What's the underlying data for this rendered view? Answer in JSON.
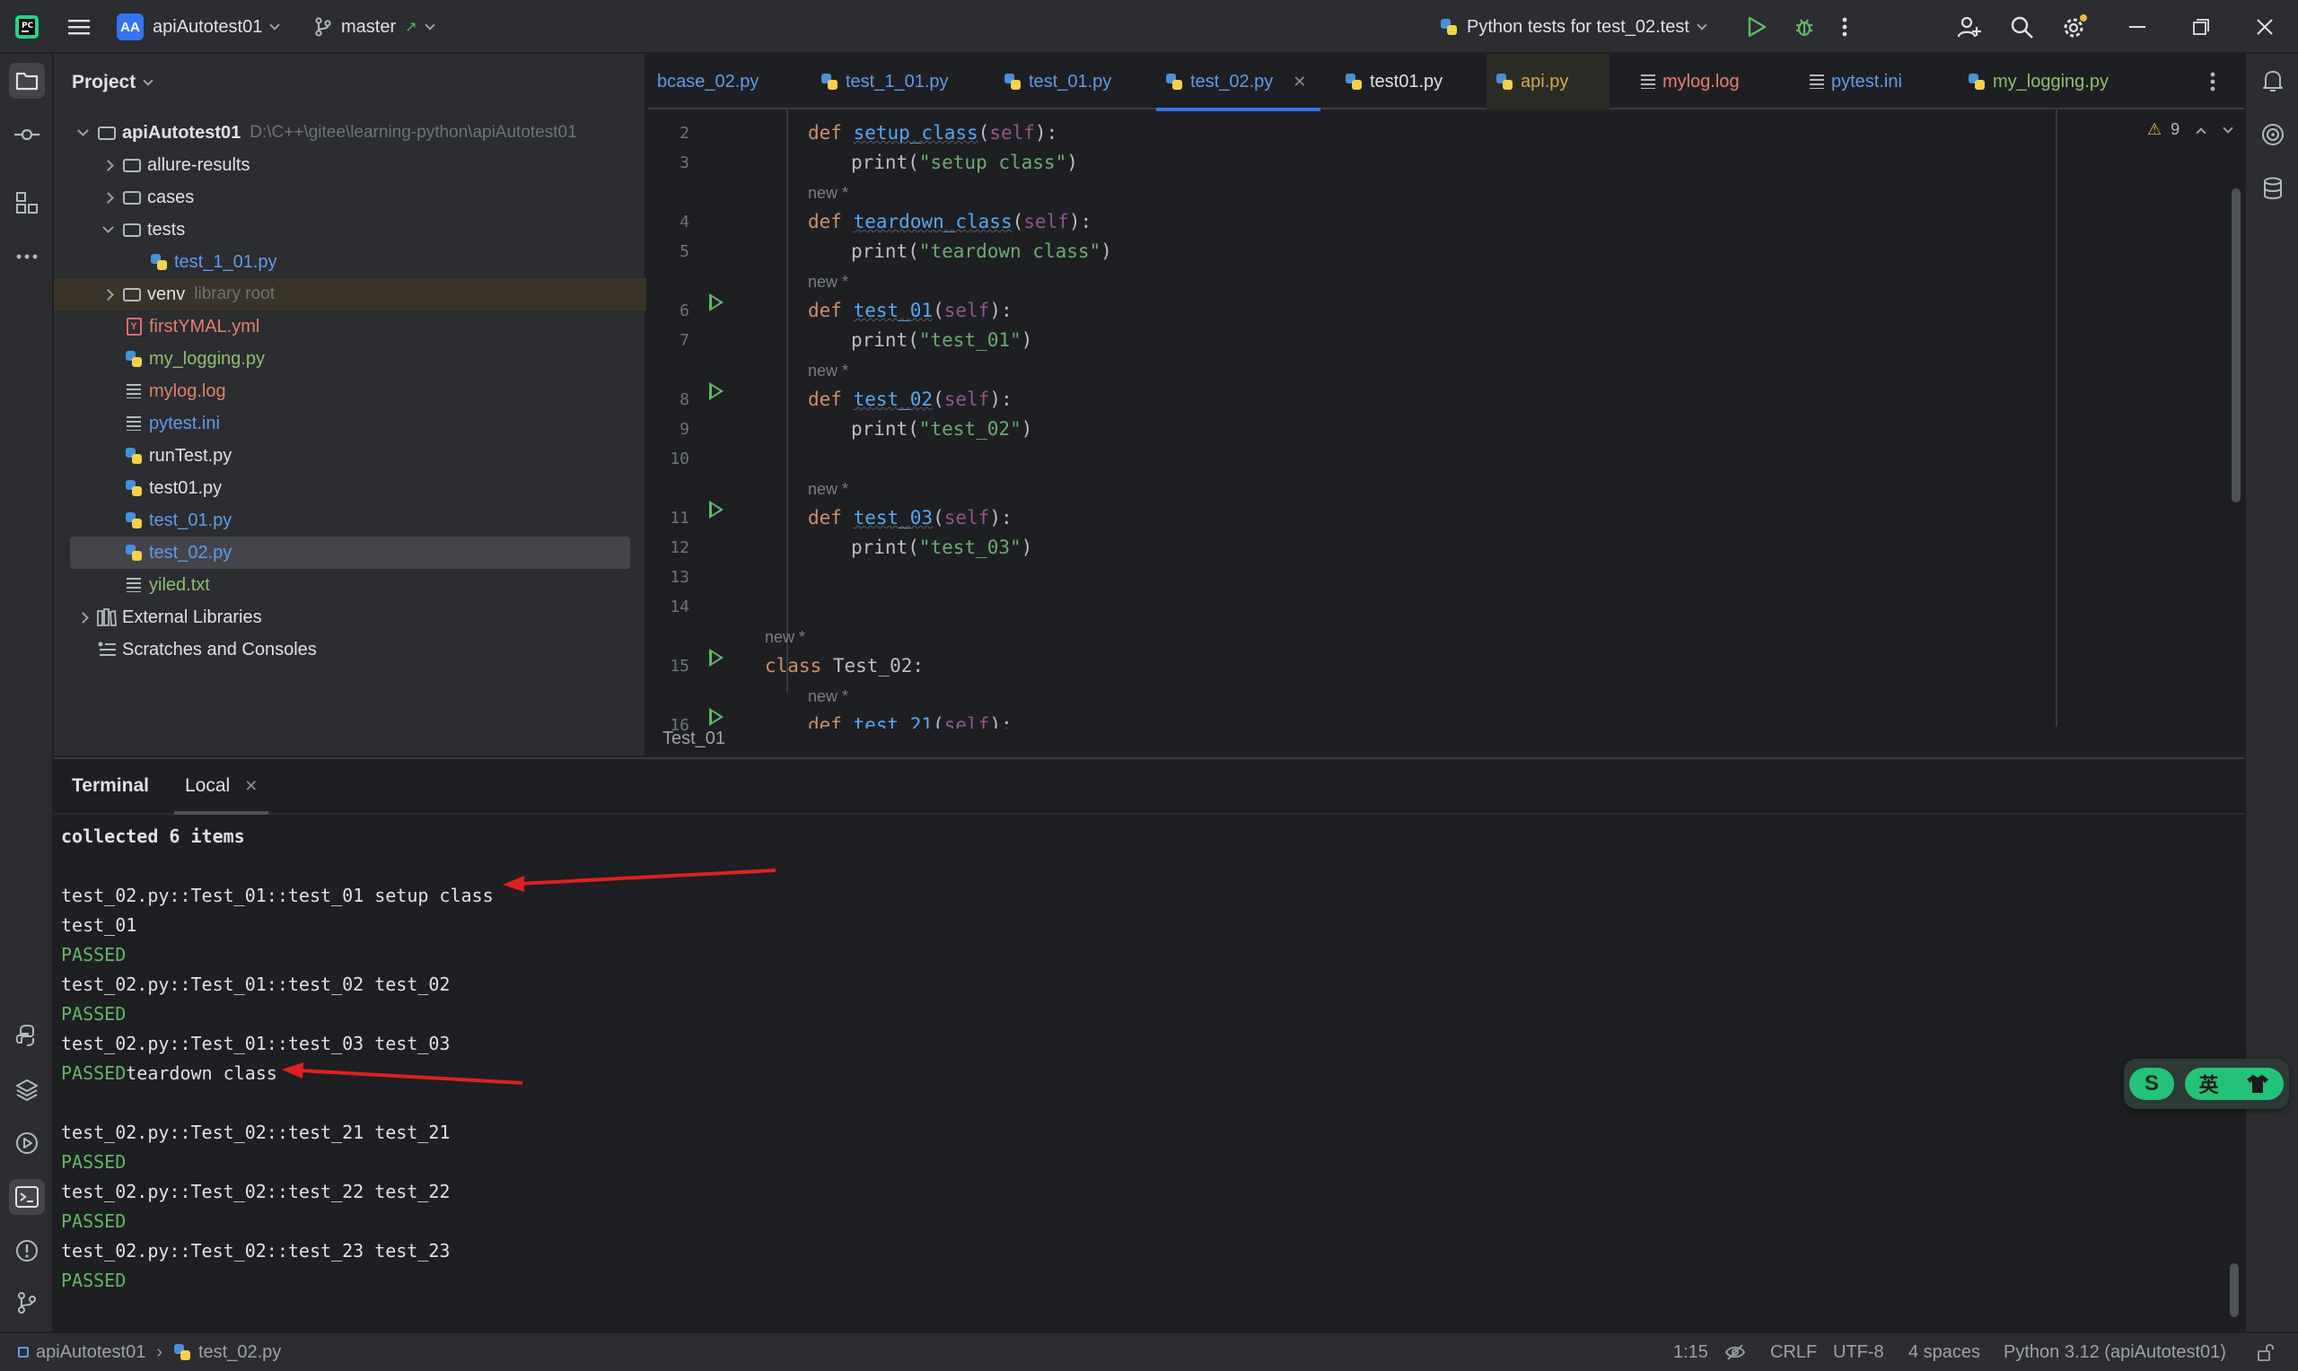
{
  "titlebar": {
    "project_badge": "AA",
    "project_name": "apiAutotest01",
    "branch": "master",
    "run_config": "Python tests for test_02.test"
  },
  "project_panel": {
    "title": "Project",
    "root_name": "apiAutotest01",
    "root_path": "D:\\C++\\gitee\\learning-python\\apiAutotest01",
    "items": [
      {
        "label": "allure-results"
      },
      {
        "label": "cases"
      },
      {
        "label": "tests"
      },
      {
        "label": "test_1_01.py"
      },
      {
        "label": "venv",
        "hint": "library root"
      },
      {
        "label": "firstYMAL.yml"
      },
      {
        "label": "my_logging.py"
      },
      {
        "label": "mylog.log"
      },
      {
        "label": "pytest.ini"
      },
      {
        "label": "runTest.py"
      },
      {
        "label": "test01.py"
      },
      {
        "label": "test_01.py"
      },
      {
        "label": "test_02.py"
      },
      {
        "label": "yiled.txt"
      },
      {
        "label": "External Libraries"
      },
      {
        "label": "Scratches and Consoles"
      }
    ]
  },
  "editor": {
    "tabs": [
      {
        "label": "bcase_02.py"
      },
      {
        "label": "test_1_01.py"
      },
      {
        "label": "test_01.py"
      },
      {
        "label": "test_02.py",
        "active": true
      },
      {
        "label": "test01.py"
      },
      {
        "label": "api.py"
      },
      {
        "label": "mylog.log"
      },
      {
        "label": "pytest.ini"
      },
      {
        "label": "my_logging.py"
      }
    ],
    "warning_count": "9",
    "hint_new": "new *",
    "line_numbers": [
      "2",
      "3",
      "4",
      "5",
      "6",
      "7",
      "8",
      "9",
      "10",
      "11",
      "12",
      "13",
      "14",
      "15",
      "16"
    ],
    "code": {
      "l2_def": "def ",
      "l2_fn": "setup_class",
      "l2_p1": "(",
      "l2_self": "self",
      "l2_p2": "):",
      "l3_print": "print(",
      "l3_str": "\"setup class\"",
      "l3_end": ")",
      "l4_def": "def ",
      "l4_fn": "teardown_class",
      "l4_p1": "(",
      "l4_self": "self",
      "l4_p2": "):",
      "l5_print": "print(",
      "l5_str": "\"teardown class\"",
      "l5_end": ")",
      "l6_def": "def ",
      "l6_fn": "test_01",
      "l6_p1": "(",
      "l6_self": "self",
      "l6_p2": "):",
      "l7_print": "print(",
      "l7_str": "\"test_01\"",
      "l7_end": ")",
      "l8_def": "def ",
      "l8_fn": "test_02",
      "l8_p1": "(",
      "l8_self": "self",
      "l8_p2": "):",
      "l9_print": "print(",
      "l9_str": "\"test_02\"",
      "l9_end": ")",
      "l11_def": "def ",
      "l11_fn": "test_03",
      "l11_p1": "(",
      "l11_self": "self",
      "l11_p2": "):",
      "l12_print": "print(",
      "l12_str": "\"test_03\"",
      "l12_end": ")",
      "l15_class": "class ",
      "l15_name": "Test_02:",
      "l16_def": "def ",
      "l16_fn": "test_21",
      "l16_p1": "(",
      "l16_self": "self",
      "l16_p2": "):"
    },
    "breadcrumb": "Test_01"
  },
  "terminal": {
    "tab_terminal": "Terminal",
    "tab_local": "Local",
    "lines": [
      "collected 6 items",
      "test_02.py::Test_01::test_01 setup class",
      "test_01",
      "PASSED",
      "test_02.py::Test_01::test_02 test_02",
      "PASSED",
      "test_02.py::Test_01::test_03 test_03",
      "PASSED",
      "teardown class",
      "test_02.py::Test_02::test_21 test_21",
      "PASSED",
      "test_02.py::Test_02::test_22 test_22",
      "PASSED",
      "test_02.py::Test_02::test_23 test_23",
      "PASSED"
    ]
  },
  "statusbar": {
    "project": "apiAutotest01",
    "file": "test_02.py",
    "position": "1:15",
    "line_sep": "CRLF",
    "encoding": "UTF-8",
    "indent": "4 spaces",
    "interpreter": "Python 3.12 (apiAutotest01)"
  },
  "ime_widget": {
    "logo": "S",
    "lang": "英"
  },
  "colors": {
    "accent": "#3574f0",
    "passed": "#5fb865",
    "annotation_arrow": "#e02020"
  }
}
